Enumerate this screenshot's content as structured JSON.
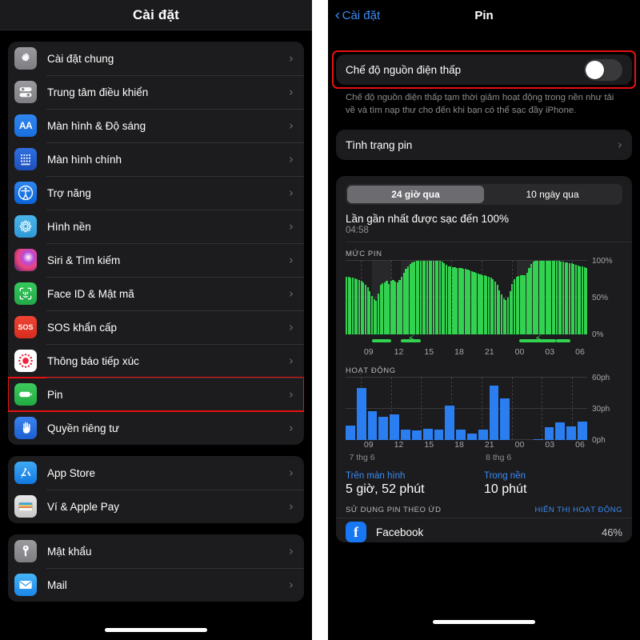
{
  "left": {
    "title": "Cài đặt",
    "groups": [
      {
        "items": [
          {
            "label": "Cài đặt chung",
            "icon": "gear-icon",
            "icon_class": "ic-gear",
            "highlight": false
          },
          {
            "label": "Trung tâm điều khiển",
            "icon": "control-center-icon",
            "icon_class": "ic-ctrl",
            "highlight": false
          },
          {
            "label": "Màn hình & Độ sáng",
            "icon": "display-brightness-icon",
            "icon_class": "ic-aa",
            "highlight": false
          },
          {
            "label": "Màn hình chính",
            "icon": "home-screen-icon",
            "icon_class": "ic-home",
            "highlight": false
          },
          {
            "label": "Trợ năng",
            "icon": "accessibility-icon",
            "icon_class": "ic-acc",
            "highlight": false
          },
          {
            "label": "Hình nền",
            "icon": "wallpaper-icon",
            "icon_class": "ic-wall",
            "highlight": false
          },
          {
            "label": "Siri & Tìm kiếm",
            "icon": "siri-icon",
            "icon_class": "ic-siri",
            "highlight": false
          },
          {
            "label": "Face ID & Mật mã",
            "icon": "face-id-icon",
            "icon_class": "ic-face",
            "highlight": false
          },
          {
            "label": "SOS khẩn cấp",
            "icon": "sos-icon",
            "icon_class": "ic-sos",
            "highlight": false
          },
          {
            "label": "Thông báo tiếp xúc",
            "icon": "exposure-notification-icon",
            "icon_class": "ic-expo",
            "highlight": false
          },
          {
            "label": "Pin",
            "icon": "battery-icon",
            "icon_class": "ic-bat",
            "highlight": true
          },
          {
            "label": "Quyền riêng tư",
            "icon": "privacy-hand-icon",
            "icon_class": "ic-priv",
            "highlight": false
          }
        ]
      },
      {
        "items": [
          {
            "label": "App Store",
            "icon": "app-store-icon",
            "icon_class": "ic-appstore",
            "highlight": false
          },
          {
            "label": "Ví & Apple Pay",
            "icon": "wallet-icon",
            "icon_class": "ic-wallet",
            "highlight": false
          }
        ]
      },
      {
        "items": [
          {
            "label": "Mật khẩu",
            "icon": "passwords-key-icon",
            "icon_class": "ic-pass",
            "highlight": false
          },
          {
            "label": "Mail",
            "icon": "mail-icon",
            "icon_class": "ic-mail",
            "highlight": false
          }
        ]
      }
    ],
    "chevron": "›"
  },
  "right": {
    "back_label": "Cài đặt",
    "back_caret": "‹",
    "title": "Pin",
    "low_power": {
      "label": "Chế độ nguồn điện thấp",
      "toggle_state": "off",
      "description": "Chế độ nguồn điện thấp tạm thời giảm hoạt động trong nền như tải về và tìm nạp thư cho đến khi bạn có thể sạc đầy iPhone."
    },
    "battery_health": {
      "label": "Tình trạng pin",
      "chevron": "›"
    },
    "segments": [
      {
        "label": "24 giờ qua",
        "active": true
      },
      {
        "label": "10 ngày qua",
        "active": false
      }
    ],
    "last_charge": {
      "title": "Lần gần nhất được sạc đến 100%",
      "time": "04:58"
    },
    "battery_level_label": "MỨC PIN",
    "activity_label": "HOẠT ĐỘNG",
    "totals": [
      {
        "heading": "Trên màn hình",
        "value": "5 giờ, 52 phút"
      },
      {
        "heading": "Trong nền",
        "value": "10 phút"
      }
    ],
    "by_app": {
      "left_label": "SỬ DỤNG PIN THEO ỨD",
      "right_label": "HIỂN THỊ HOẠT ĐỘNG"
    },
    "app_rows": [
      {
        "name": "Facebook",
        "percent": "46%",
        "icon": "facebook-icon",
        "glyph": "f"
      }
    ]
  },
  "chart_data": [
    {
      "type": "bar",
      "title": "MỨC PIN",
      "xlabel": "",
      "ylabel": "%",
      "ylim": [
        0,
        100
      ],
      "yticks": [
        "0%",
        "50%",
        "100%"
      ],
      "xticks": [
        "09",
        "12",
        "15",
        "18",
        "21",
        "00",
        "03",
        "06"
      ],
      "series_color": "#32d14f",
      "values": [
        78,
        78,
        77,
        77,
        76,
        75,
        74,
        73,
        71,
        68,
        64,
        59,
        52,
        48,
        46,
        56,
        68,
        70,
        71,
        73,
        69,
        73,
        74,
        72,
        71,
        74,
        78,
        84,
        89,
        93,
        96,
        98,
        99,
        100,
        100,
        100,
        100,
        100,
        100,
        100,
        100,
        100,
        100,
        100,
        100,
        99,
        97,
        95,
        93,
        92,
        91,
        91,
        90,
        90,
        90,
        89,
        89,
        88,
        87,
        86,
        85,
        84,
        83,
        82,
        81,
        80,
        79,
        78,
        77,
        75,
        72,
        67,
        60,
        54,
        49,
        47,
        50,
        59,
        69,
        75,
        78,
        79,
        80,
        80,
        81,
        84,
        90,
        96,
        99,
        100,
        100,
        100,
        100,
        100,
        100,
        100,
        100,
        100,
        100,
        100,
        100,
        99,
        99,
        98,
        98,
        97,
        97,
        96,
        95,
        94,
        93,
        92,
        91,
        90
      ],
      "charging_segments": [
        {
          "start_pct": 11,
          "end_pct": 19
        },
        {
          "start_pct": 23,
          "end_pct": 31,
          "bolt": true
        },
        {
          "start_pct": 72,
          "end_pct": 87,
          "bolt": true
        },
        {
          "start_pct": 87,
          "end_pct": 93
        }
      ],
      "shaded_regions": [
        {
          "start_pct": 11,
          "end_pct": 19
        },
        {
          "start_pct": 23,
          "end_pct": 29
        },
        {
          "start_pct": 71,
          "end_pct": 78
        }
      ]
    },
    {
      "type": "bar",
      "title": "HOẠT ĐỘNG",
      "xlabel": "",
      "ylabel": "ph",
      "ylim": [
        0,
        60
      ],
      "yticks": [
        "0ph",
        "30ph",
        "60ph"
      ],
      "xticks": [
        "09",
        "12",
        "15",
        "18",
        "21",
        "00",
        "03",
        "06"
      ],
      "date_labels": [
        "7 thg 6",
        "8 thg 6"
      ],
      "series_color": "#2a7ef0",
      "values": [
        14,
        50,
        28,
        22,
        25,
        10,
        9,
        11,
        10,
        33,
        10,
        6,
        10,
        52,
        40,
        0,
        0,
        1,
        12,
        17,
        13,
        18
      ]
    }
  ]
}
